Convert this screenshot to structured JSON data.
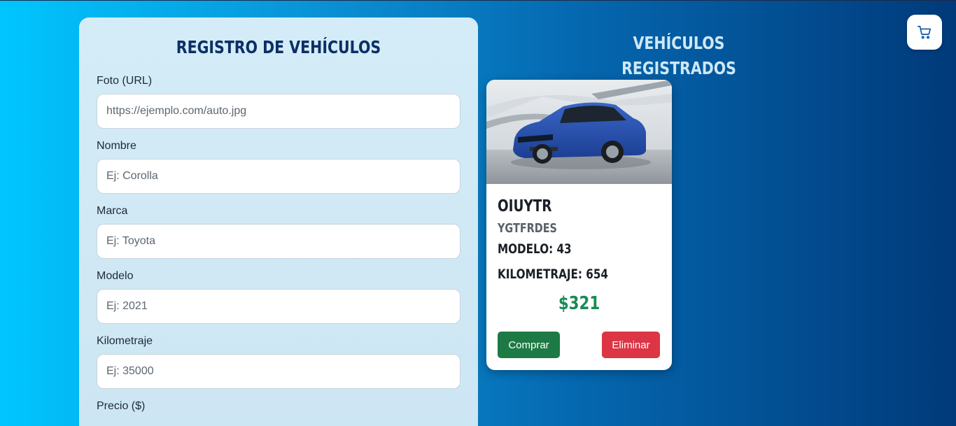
{
  "form": {
    "title": "REGISTRO DE VEHÍCULOS",
    "fields": [
      {
        "label": "Foto (URL)",
        "placeholder": "https://ejemplo.com/auto.jpg"
      },
      {
        "label": "Nombre",
        "placeholder": "Ej: Corolla"
      },
      {
        "label": "Marca",
        "placeholder": "Ej: Toyota"
      },
      {
        "label": "Modelo",
        "placeholder": "Ej: 2021"
      },
      {
        "label": "Kilometraje",
        "placeholder": "Ej: 35000"
      },
      {
        "label": "Precio ($)"
      }
    ]
  },
  "list": {
    "title": "VEHÍCULOS REGISTRADOS"
  },
  "cart": {
    "icon": "cart-icon"
  },
  "vehicle": {
    "name": "OIUYTR",
    "brand": "YGTFRDES",
    "model_line": "MODELO: 43",
    "km_line": "KILOMETRAJE: 654",
    "price": "$321",
    "buy_label": "Comprar",
    "delete_label": "Eliminar"
  },
  "colors": {
    "title_dark": "#0b2f66",
    "price_green": "#1a8a55",
    "buy_green": "#1e7a45",
    "delete_red": "#dc3545"
  }
}
